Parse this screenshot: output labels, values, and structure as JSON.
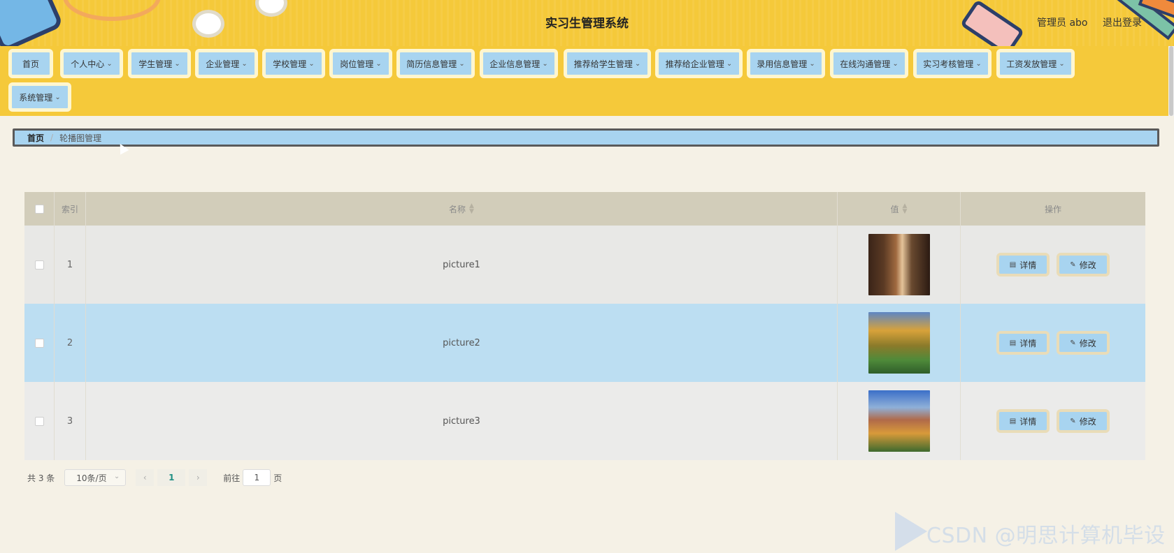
{
  "header": {
    "title": "实习生管理系统",
    "admin": "管理员 abo",
    "logout": "退出登录"
  },
  "nav": {
    "items": [
      {
        "label": "首页",
        "has_menu": false
      },
      {
        "label": "个人中心",
        "has_menu": true
      },
      {
        "label": "学生管理",
        "has_menu": true
      },
      {
        "label": "企业管理",
        "has_menu": true
      },
      {
        "label": "学校管理",
        "has_menu": true
      },
      {
        "label": "岗位管理",
        "has_menu": true
      },
      {
        "label": "简历信息管理",
        "has_menu": true
      },
      {
        "label": "企业信息管理",
        "has_menu": true
      },
      {
        "label": "推荐给学生管理",
        "has_menu": true
      },
      {
        "label": "推荐给企业管理",
        "has_menu": true
      },
      {
        "label": "录用信息管理",
        "has_menu": true
      },
      {
        "label": "在线沟通管理",
        "has_menu": true
      },
      {
        "label": "实习考核管理",
        "has_menu": true
      },
      {
        "label": "工资发放管理",
        "has_menu": true
      },
      {
        "label": "系统管理",
        "has_menu": true
      }
    ]
  },
  "breadcrumb": {
    "home": "首页",
    "separator": "/",
    "current": "轮播图管理"
  },
  "table": {
    "columns": [
      "索引",
      "名称",
      "值",
      "操作"
    ],
    "rows": [
      {
        "index": "1",
        "name": "picture1",
        "image": "library-corridor"
      },
      {
        "index": "2",
        "name": "picture2",
        "image": "autumn-campus-lawn"
      },
      {
        "index": "3",
        "name": "picture3",
        "image": "campus-garden-buildings"
      }
    ],
    "actions": {
      "detail": "详情",
      "edit": "修改"
    }
  },
  "pagination": {
    "total": "共 3 条",
    "page_size": "10条/页",
    "current_page": "1",
    "goto_prefix": "前往",
    "goto_value": "1",
    "goto_suffix": "页"
  },
  "watermark": "CSDN @明思计算机毕设",
  "colors": {
    "header_bg": "#f5c93a",
    "nav_button": "#a8d4f0",
    "page_bg": "#f5f1e6",
    "table_header": "#d2cdba",
    "row_highlight": "#bcdef2"
  }
}
